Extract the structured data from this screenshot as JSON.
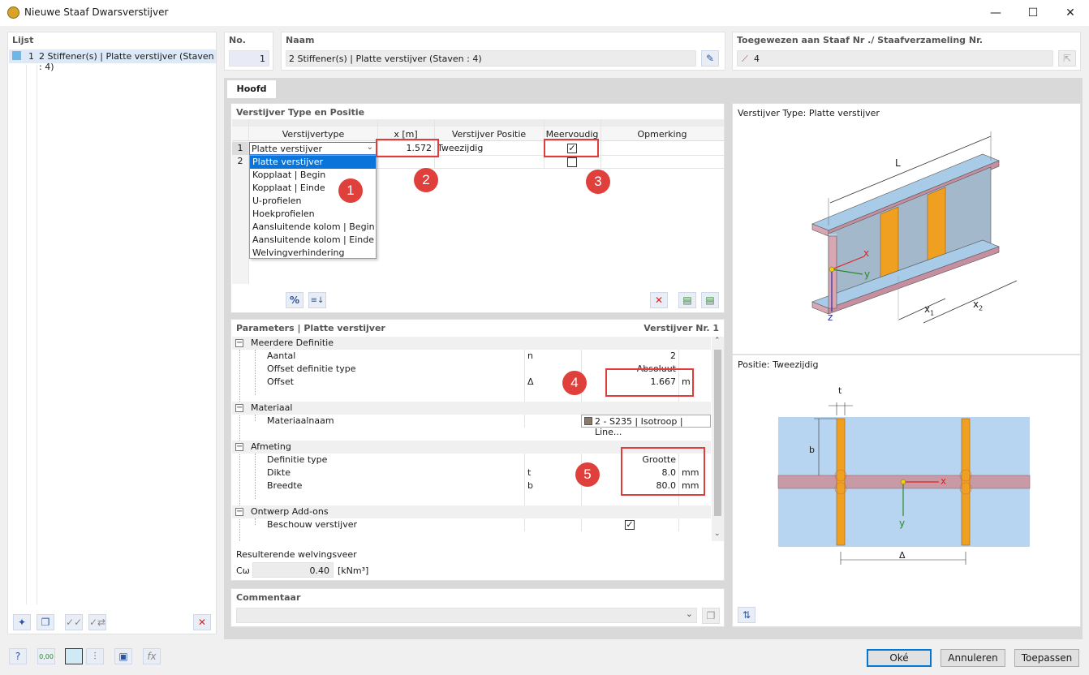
{
  "window": {
    "title": "Nieuwe Staaf Dwarsverstijver",
    "minimize": "—",
    "maximize": "☐",
    "close": "✕"
  },
  "list": {
    "header": "Lijst",
    "item_no": "1",
    "item_label": "2 Stiffener(s) | Platte verstijver (Staven : 4)"
  },
  "no": {
    "label": "No.",
    "value": "1"
  },
  "naam": {
    "label": "Naam",
    "value": "2 Stiffener(s) | Platte verstijver (Staven : 4)"
  },
  "assigned": {
    "label": "Toegewezen aan Staaf Nr ./ Staafverzameling Nr.",
    "value": "4"
  },
  "tab": {
    "main": "Hoofd"
  },
  "typeTable": {
    "title": "Verstijver Type en Positie",
    "headers": [
      "Verstijvertype",
      "x [m]",
      "Verstijver Positie",
      "Meervoudig",
      "Opmerking"
    ],
    "rows": [
      {
        "no": "1",
        "type": "Platte verstijver",
        "x": "1.572",
        "position": "Tweezijdig"
      },
      {
        "no": "2"
      }
    ],
    "dropdown": [
      "Platte verstijver",
      "Kopplaat | Begin",
      "Kopplaat | Einde",
      "U-profielen",
      "Hoekprofielen",
      "Aansluitende kolom | Begin",
      "Aansluitende kolom | Einde",
      "Welvingverhindering"
    ]
  },
  "badges": [
    "1",
    "2",
    "3",
    "4",
    "5"
  ],
  "params": {
    "title": "Parameters | Platte verstijver",
    "right": "Verstijver Nr. 1",
    "g1": "Meerdere Definitie",
    "aantal": "Aantal",
    "aantal_sym": "n",
    "aantal_val": "2",
    "offsettype": "Offset definitie type",
    "offsettype_val": "Absoluut",
    "offset": "Offset",
    "offset_sym": "Δ",
    "offset_val": "1.667",
    "offset_unit": "m",
    "g2": "Materiaal",
    "mat": "Materiaalnaam",
    "mat_val": "2 - S235 | Isotroop | Line...",
    "g3": "Afmeting",
    "deftype": "Definitie type",
    "deftype_val": "Grootte",
    "dikte": "Dikte",
    "dikte_sym": "t",
    "dikte_val": "8.0",
    "dikte_unit": "mm",
    "breedte": "Breedte",
    "breedte_sym": "b",
    "breedte_val": "80.0",
    "breedte_unit": "mm",
    "g4": "Ontwerp Add-ons",
    "beschouw": "Beschouw verstijver"
  },
  "resulting": {
    "label": "Resulterende welvingsveer",
    "sym": "Cω",
    "value": "0.40",
    "unit": "[kNm³]"
  },
  "comment": {
    "label": "Commentaar"
  },
  "preview1": {
    "title": "Verstijver Type: Platte verstijver",
    "L": "L",
    "x": "x",
    "y": "y",
    "z": "z",
    "x1": "x",
    "x1sub": "1",
    "x2": "x",
    "x2sub": "2"
  },
  "preview2": {
    "title": "Positie: Tweezijdig",
    "t": "t",
    "b": "b",
    "x": "x",
    "y": "y",
    "delta": "Δ"
  },
  "buttons": {
    "ok": "Oké",
    "cancel": "Annuleren",
    "apply": "Toepassen"
  },
  "icons": {
    "pct": "%",
    "sort": "≡↓",
    "delete": "✕",
    "check": "✓",
    "fx": "fx",
    "zero": "0,00"
  }
}
